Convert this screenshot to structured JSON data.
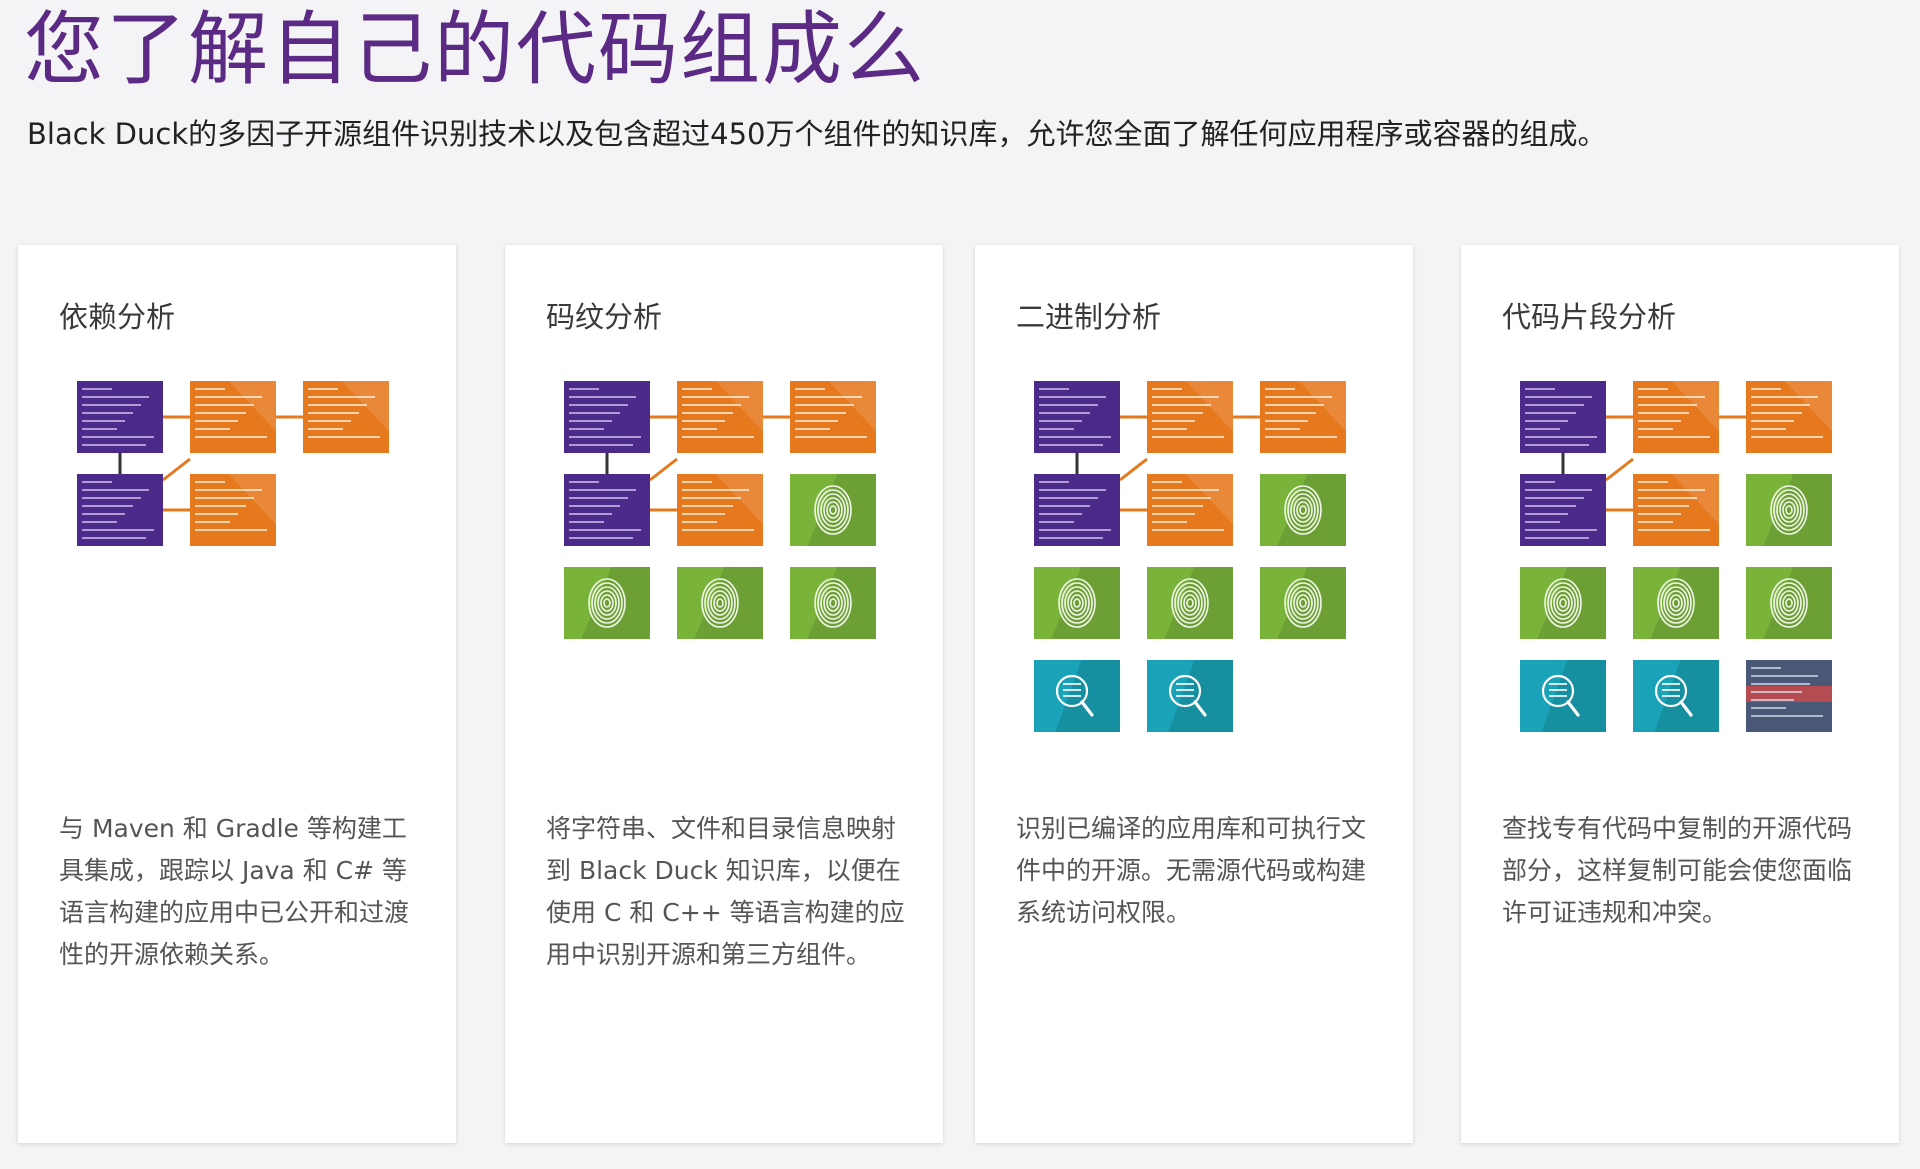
{
  "hero": {
    "title": "您了解自己的代码组成么",
    "subtitle": "Black Duck的多因子开源组件识别技术以及包含超过450万个组件的知识库，允许您全面了解任何应用程序或容器的组成。"
  },
  "colors": {
    "title": "#5b2a84",
    "purple_tile": "#4b2a8a",
    "orange_tile": "#e6781e",
    "green_tile": "#7ab33a",
    "teal_tile": "#1aa3b8",
    "code_tile": "#4a5878",
    "connector": "#e6781e"
  },
  "cards": [
    {
      "title": "依赖分析",
      "description": "与 Maven 和 Gradle 等构建工具集成，跟踪以 Java 和 C# 等语言构建的应用中已公开和过渡性的开源依赖关系。",
      "tiles": [
        [
          "purple-code",
          "orange-xml",
          "orange-xml"
        ],
        [
          "purple-code",
          "orange-xml"
        ]
      ]
    },
    {
      "title": "码纹分析",
      "description": "将字符串、文件和目录信息映射到 Black Duck 知识库，以便在使用 C 和 C++ 等语言构建的应用中识别开源和第三方组件。",
      "tiles": [
        [
          "purple-code",
          "orange-xml",
          "orange-xml"
        ],
        [
          "purple-code",
          "orange-xml",
          "green-fingerprint"
        ],
        [
          "green-fingerprint",
          "green-fingerprint",
          "green-fingerprint"
        ]
      ]
    },
    {
      "title": "二进制分析",
      "description": "识别已编译的应用库和可执行文件中的开源。无需源代码或构建系统访问权限。",
      "tiles": [
        [
          "purple-code",
          "orange-xml",
          "orange-xml"
        ],
        [
          "purple-code",
          "orange-xml",
          "green-fingerprint"
        ],
        [
          "green-fingerprint",
          "green-fingerprint",
          "green-fingerprint"
        ],
        [
          "teal-binary",
          "teal-binary"
        ]
      ]
    },
    {
      "title": "代码片段分析",
      "description": "查找专有代码中复制的开源代码部分，这样复制可能会使您面临许可证违规和冲突。",
      "tiles": [
        [
          "purple-code",
          "orange-xml",
          "orange-xml"
        ],
        [
          "purple-code",
          "orange-xml",
          "green-fingerprint"
        ],
        [
          "green-fingerprint",
          "green-fingerprint",
          "green-fingerprint"
        ],
        [
          "teal-binary",
          "teal-binary",
          "slate-snippet"
        ]
      ]
    }
  ]
}
